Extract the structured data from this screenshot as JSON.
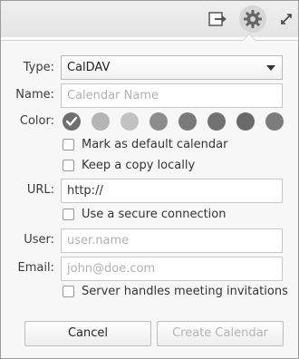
{
  "toolbar": {
    "export_icon": "export-icon",
    "settings_icon": "gear-icon",
    "expand_icon": "expand-icon"
  },
  "form": {
    "type_label": "Type:",
    "type_value": "CalDAV",
    "name_label": "Name:",
    "name_placeholder": "Calendar Name",
    "color_label": "Color:",
    "colors": [
      {
        "hex": "#6f6f6f",
        "selected": true
      },
      {
        "hex": "#b5b5b5",
        "selected": false
      },
      {
        "hex": "#c2c2c2",
        "selected": false
      },
      {
        "hex": "#8c8c8c",
        "selected": false
      },
      {
        "hex": "#7a7a7a",
        "selected": false
      },
      {
        "hex": "#727272",
        "selected": false
      },
      {
        "hex": "#6a6a6a",
        "selected": false
      },
      {
        "hex": "#7c7c7c",
        "selected": false
      }
    ],
    "default_calendar_label": "Mark as default calendar",
    "keep_copy_label": "Keep a copy locally",
    "url_label": "URL:",
    "url_value": "http://",
    "secure_label": "Use a secure connection",
    "user_label": "User:",
    "user_placeholder": "user.name",
    "email_label": "Email:",
    "email_placeholder": "john@doe.com",
    "invitations_label": "Server handles meeting invitations"
  },
  "buttons": {
    "cancel_label": "Cancel",
    "create_label": "Create Calendar"
  }
}
